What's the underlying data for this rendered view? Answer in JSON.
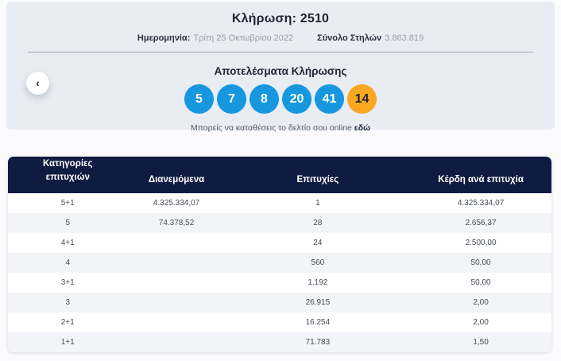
{
  "draw": {
    "title": "Κλήρωση: 2510",
    "date_label": "Ημερομηνία:",
    "date_value": "Τρίτη 25 Οκτωβρίου 2022",
    "columns_label": "Σύνολο Στηλών",
    "columns_value": "3.863.819"
  },
  "results": {
    "heading": "Αποτελέσματα Κλήρωσης",
    "numbers": [
      "5",
      "7",
      "8",
      "20",
      "41"
    ],
    "joker": "14",
    "note_text": "Μπορείς να καταθέσεις το δελτίο σου online",
    "note_link": "εδώ"
  },
  "icons": {
    "prev": "‹"
  },
  "colors": {
    "ball_blue": "#1697de",
    "ball_orange": "#f8a823",
    "header_navy": "#101b41"
  },
  "table": {
    "headers": {
      "category": "Κατηγορίες επιτυχιών",
      "distributed": "Διανεμόμενα",
      "winners": "Επιτυχίες",
      "prize": "Κέρδη ανά επιτυχία"
    },
    "rows": [
      {
        "category": "5+1",
        "distributed": "4.325.334,07",
        "winners": "1",
        "prize": "4.325.334,07"
      },
      {
        "category": "5",
        "distributed": "74.378,52",
        "winners": "28",
        "prize": "2.656,37"
      },
      {
        "category": "4+1",
        "distributed": "",
        "winners": "24",
        "prize": "2.500,00"
      },
      {
        "category": "4",
        "distributed": "",
        "winners": "560",
        "prize": "50,00"
      },
      {
        "category": "3+1",
        "distributed": "",
        "winners": "1.192",
        "prize": "50,00"
      },
      {
        "category": "3",
        "distributed": "",
        "winners": "26.915",
        "prize": "2,00"
      },
      {
        "category": "2+1",
        "distributed": "",
        "winners": "16.254",
        "prize": "2,00"
      },
      {
        "category": "1+1",
        "distributed": "",
        "winners": "71.783",
        "prize": "1,50"
      }
    ]
  }
}
